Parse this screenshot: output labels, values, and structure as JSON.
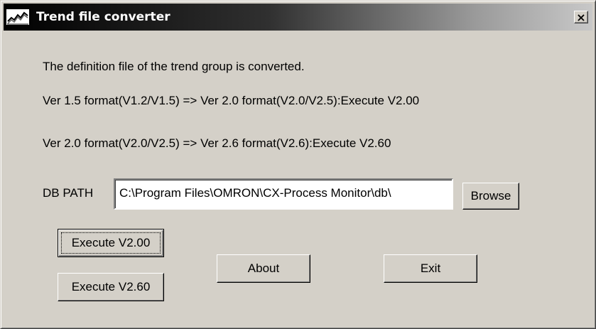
{
  "window": {
    "title": "Trend file converter",
    "close_glyph": "×",
    "app_icon": "trend-chart-icon",
    "close_icon": "close-icon"
  },
  "content": {
    "description": "The definition file of the trend group is converted.",
    "conversion_v200": "Ver 1.5 format(V1.2/V1.5) => Ver 2.0 format(V2.0/V2.5):Execute V2.00",
    "conversion_v260": "Ver 2.0 format(V2.0/V2.5) => Ver 2.6 format(V2.6):Execute V2.60",
    "db_path_label": "DB PATH",
    "db_path_value": "C:\\Program Files\\OMRON\\CX-Process Monitor\\db\\"
  },
  "buttons": {
    "browse": "Browse",
    "execute_v200": "Execute V2.00",
    "execute_v260": "Execute V2.60",
    "about": "About",
    "exit": "Exit"
  },
  "colors": {
    "window_face": "#d4d0c8",
    "title_gradient_start": "#000000",
    "title_gradient_end": "#c8c8c8",
    "title_text": "#ffffff"
  }
}
